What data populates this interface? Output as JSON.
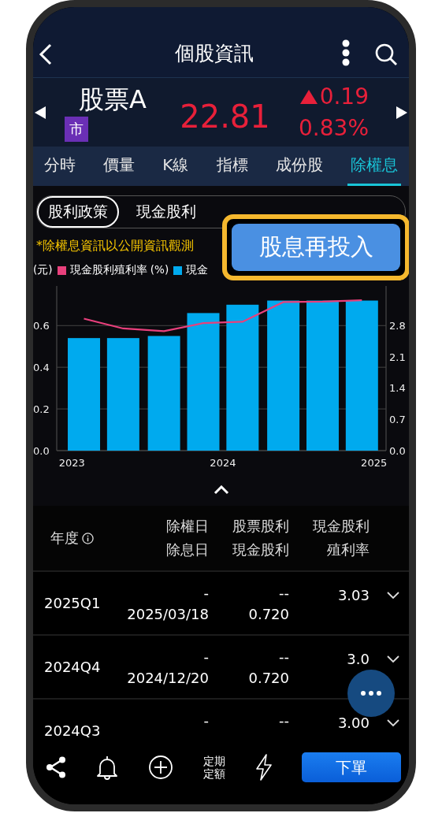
{
  "header": {
    "title": "個股資訊"
  },
  "stock": {
    "name": "股票A",
    "badge": "市",
    "price": "22.81",
    "rising": true,
    "change": "0.19",
    "change_pct": "0.83%"
  },
  "tabs": [
    {
      "label": "分時",
      "selected": false
    },
    {
      "label": "價量",
      "selected": false
    },
    {
      "label": "K線",
      "selected": false
    },
    {
      "label": "指標",
      "selected": false
    },
    {
      "label": "成份股",
      "selected": false
    },
    {
      "label": "除權息",
      "selected": true
    }
  ],
  "sub_tabs": [
    {
      "label": "股利政策",
      "selected": true
    },
    {
      "label": "現金股利",
      "selected": false
    }
  ],
  "notice": "*除權息資訊以公開資訊觀測",
  "chart": {
    "chart_data": {
      "type": "bar",
      "ylabel": "(元)",
      "x": [
        2023.08,
        2023.34,
        2023.61,
        2023.87,
        2024.13,
        2024.4,
        2024.66,
        2024.92
      ],
      "xlim": [
        2022.9,
        2025.08
      ],
      "grid": true,
      "xticks": [
        2023,
        2024,
        2025
      ],
      "ylim": [
        0,
        0.79
      ],
      "yticks": [
        {
          "value": 0,
          "label": "0.0"
        },
        0.2,
        0.4,
        0.6
      ],
      "y2lim": [
        0,
        3.68
      ],
      "y2ticks": [
        {
          "value": 0,
          "label": "0.0"
        },
        0.7,
        1.4,
        2.1,
        2.8
      ],
      "series": [
        {
          "name": "現金股利殖利率 (%)",
          "color": "#e8407c",
          "type": "line",
          "axis": "y2",
          "values": [
            2.95,
            2.73,
            2.67,
            2.85,
            2.88,
            3.32,
            3.33,
            3.36
          ]
        },
        {
          "name": "現金",
          "color": "#00aaee",
          "values": [
            0.54,
            0.54,
            0.55,
            0.66,
            0.7,
            0.72,
            0.72,
            0.72
          ]
        }
      ]
    }
  },
  "table": {
    "columns": [
      {
        "top": "年度",
        "info": true
      },
      {
        "top": "除權日",
        "bottom": "除息日"
      },
      {
        "top": "股票股利",
        "bottom": "現金股利"
      },
      {
        "top": "現金股利",
        "bottom": "殖利率"
      }
    ],
    "rows": [
      {
        "period": "2025Q1",
        "ex_rights_date": "-",
        "ex_dividend_date": "2025/03/18",
        "stock_dividend": "--",
        "cash_dividend": "0.720",
        "yield": "3.03",
        "expanded": false
      },
      {
        "period": "2024Q4",
        "ex_rights_date": "-",
        "ex_dividend_date": "2024/12/20",
        "stock_dividend": "--",
        "cash_dividend": "0.720",
        "yield": "3.0",
        "expanded": false
      },
      {
        "period": "2024Q3",
        "ex_rights_date": "-",
        "stock_dividend": "--",
        "yield": "3.00",
        "expanded": false
      }
    ]
  },
  "popup": {
    "label": "股息再投入"
  },
  "bottom_bar": {
    "actions": [
      {
        "kind": "share"
      },
      {
        "kind": "alert"
      },
      {
        "kind": "add"
      },
      {
        "kind": "text",
        "label": "定期定額"
      },
      {
        "kind": "flash"
      }
    ],
    "order_button": "下單"
  }
}
